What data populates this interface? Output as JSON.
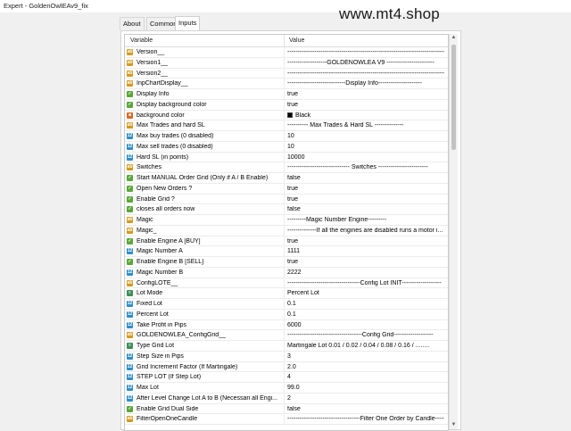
{
  "window": {
    "title": "Expert - GoldenOwlEAv9_fix"
  },
  "watermark": "www.mt4.shop",
  "tabs": [
    {
      "label": "About"
    },
    {
      "label": "Common"
    },
    {
      "label": "Inputs"
    }
  ],
  "table": {
    "headers": {
      "variable": "Variable",
      "value": "Value"
    },
    "rows": [
      {
        "type": "ab",
        "name": "Version__",
        "value": "-------------------------------------------------------------------------------------"
      },
      {
        "type": "ab",
        "name": "Version1__",
        "value": "-------------------GOLDENOWLEA V9 -----------------------"
      },
      {
        "type": "ab",
        "name": "Version2__",
        "value": "-------------------------------------------------------------------------------------"
      },
      {
        "type": "ab",
        "name": "InpChartDisplay__",
        "value": "----------------------------Display Info---------------------"
      },
      {
        "type": "bool",
        "name": "Display Info",
        "value": "true"
      },
      {
        "type": "bool",
        "name": "Display background color",
        "value": "true"
      },
      {
        "type": "color",
        "name": "background color",
        "value": "Black"
      },
      {
        "type": "ab",
        "name": "Max Trades and hard SL",
        "value": "---------- Max Trades & Hard SL --------------"
      },
      {
        "type": "num",
        "name": "Max buy trades (0 disabled)",
        "value": "10"
      },
      {
        "type": "num",
        "name": "Max sell trades (0 disabled)",
        "value": "10"
      },
      {
        "type": "num",
        "name": "Hard SL (in points)",
        "value": "10000"
      },
      {
        "type": "ab",
        "name": "Switches",
        "value": "------------------------------ Switches ------------------------"
      },
      {
        "type": "bool",
        "name": "Start MANUAL Order  Grid  (Only if A / B Enable)",
        "value": "false"
      },
      {
        "type": "bool",
        "name": "Open New Orders ?",
        "value": "true"
      },
      {
        "type": "bool",
        "name": "Enable Grid ?",
        "value": "true"
      },
      {
        "type": "bool",
        "name": "closes all orders now",
        "value": "false"
      },
      {
        "type": "ab",
        "name": "Magic",
        "value": "---------Magic Number Engine---------"
      },
      {
        "type": "ab",
        "name": "Magic_",
        "value": "--------------If all the engines are disabled runs a motor i..."
      },
      {
        "type": "bool",
        "name": "Enable Engine A   [BUY]",
        "value": "true"
      },
      {
        "type": "num",
        "name": "Magic Number  A",
        "value": "1111"
      },
      {
        "type": "bool",
        "name": "Enable Engine B   [SELL]",
        "value": "true"
      },
      {
        "type": "num",
        "name": "Magic Number  B",
        "value": "2222"
      },
      {
        "type": "ab",
        "name": "ConfigLOTE__",
        "value": "-----------------------------------Config Lot INIT-------------------"
      },
      {
        "type": "enum",
        "name": "Lot Mode",
        "value": "Percent Lot"
      },
      {
        "type": "num",
        "name": "Fixed Lot",
        "value": "0.1"
      },
      {
        "type": "num",
        "name": "Percent Lot",
        "value": "0.1"
      },
      {
        "type": "num",
        "name": "Take Profit in Pips",
        "value": "6000"
      },
      {
        "type": "ab",
        "name": "GOLDENOWLEA_ConfigGrid__",
        "value": "------------------------------------Config Grid-------------------"
      },
      {
        "type": "enum",
        "name": "Type Grid Lot",
        "value": "Martingale Lot  0.01 / 0.02 / 0.04 / 0.08 / 0.16 / ........"
      },
      {
        "type": "num",
        "name": "Step Size in Pips",
        "value": "3"
      },
      {
        "type": "num",
        "name": "Grid Increment Factor (If Martingale)",
        "value": "2.0"
      },
      {
        "type": "num",
        "name": "STEP LOT (If  Step Lot)",
        "value": "4"
      },
      {
        "type": "num",
        "name": "Max Lot",
        "value": "99.0"
      },
      {
        "type": "num",
        "name": "After Level Change Lot A to B (Necessari all Engi...",
        "value": "2"
      },
      {
        "type": "bool",
        "name": "Enable Grid Dual Side",
        "value": "false"
      },
      {
        "type": "ab",
        "name": "FilterOpenOneCandle",
        "value": "-----------------------------------Filter One Order by Candle-----------"
      }
    ]
  }
}
